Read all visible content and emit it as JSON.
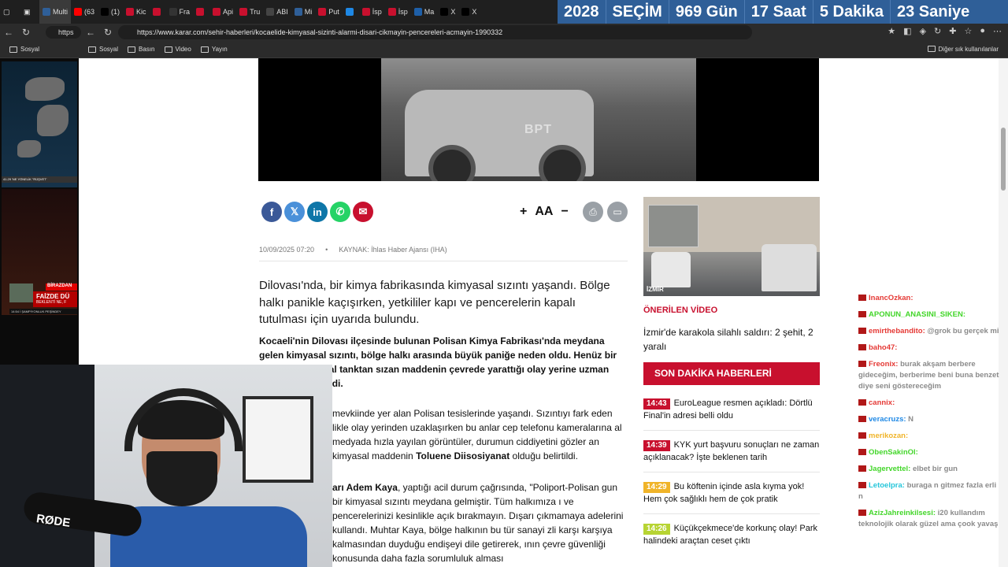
{
  "tabs": [
    {
      "label": "Multi",
      "color": "#2f5f98",
      "active": true
    },
    {
      "label": "(63",
      "color": "#ff0000"
    },
    {
      "label": "(1)",
      "color": "#000000"
    },
    {
      "label": "Kic",
      "color": "#c8102e"
    },
    {
      "label": "",
      "color": "#c8102e"
    },
    {
      "label": "Fra",
      "color": "#333333"
    },
    {
      "label": "",
      "color": "#c8102e"
    },
    {
      "label": "Api",
      "color": "#c8102e"
    },
    {
      "label": "Tru",
      "color": "#c8102e"
    },
    {
      "label": "ABI",
      "color": "#444444"
    },
    {
      "label": "Mi",
      "color": "#2f5f98"
    },
    {
      "label": "Put",
      "color": "#c8102e"
    },
    {
      "label": "",
      "color": "#1e88e5"
    },
    {
      "label": "İsp",
      "color": "#c8102e"
    },
    {
      "label": "İsp",
      "color": "#c8102e"
    },
    {
      "label": "Ma",
      "color": "#1e5fa8"
    },
    {
      "label": "X",
      "color": "#000000"
    },
    {
      "label": "X",
      "color": "#000000"
    }
  ],
  "countdown": {
    "year": "2028",
    "label": "SEÇİM",
    "days": "969 Gün",
    "hours": "17 Saat",
    "minutes": "5 Dakika",
    "seconds": "23 Saniye"
  },
  "address": {
    "mini": "https",
    "url": "https://www.karar.com/sehir-haberleri/kocaelide-kimyasal-sizinti-alarmi-disari-cikmayin-pencereleri-acmayin-1990332"
  },
  "bookmarks": {
    "items": [
      "Sosyal",
      "Basın",
      "Video",
      "Yayın"
    ],
    "first": "Sosyal",
    "other": "Diğer sık kullanılanlar"
  },
  "left_panel": {
    "ticker": "41.29   'NE YÖNELİK \"RÜŞVET'",
    "band_title": "FAİZDE DÜ",
    "band_sub": "BEKLENTİ NE, F",
    "band_tag": "BİRAZDAN",
    "bottom": "14:54  İ ŞAMPİYONLUK PEŞİNDEY"
  },
  "video": {
    "watermark": "BPT"
  },
  "share": {
    "facebook": "f",
    "x": "𝕏",
    "linkedin": "in",
    "whatsapp": "✆",
    "email": "✉"
  },
  "font_controls": {
    "plus": "+",
    "aa": "AA",
    "minus": "−"
  },
  "article": {
    "date": "10/09/2025 07:20",
    "source": "KAYNAK: İhlas Haber Ajansı (IHA)",
    "lead": "Dilovası'nda, bir kimya fabrikasında kimyasal sızıntı yaşandı. Bölge halkı panikle kaçışırken, yetkililer kapı ve pencerelerin kapalı tutulması için uyarıda bulundu.",
    "bold_para": "Kocaeli'nin Dilovası ilçesinde bulunan Polisan Kimya Fabrikası'nda meydana gelen kimyasal sızıntı, bölge halkı arasında büyük paniğe neden oldu. Henüz bir sebeple kimyasal tanktan sızan maddenin çevrede yarattığı olay yerine uzman ekipler sevk edildi.",
    "p1_a": "mevkiinde yer alan Polisan tesislerinde yaşandı. Sızıntıyı fark eden likle olay yerinden uzaklaşırken bu anlar cep telefonu kameralarına al medyada hızla yayılan görüntüler, durumun ciddiyetini gözler an kimyasal maddenin ",
    "p1_bold": "Toluene Diisosiyanat",
    "p1_b": " olduğu belirtildi.",
    "p2_bold": "arı Adem Kaya",
    "p2_a": ", yaptığı acil durum çağrısında, \"Poliport-Polisan gun bir kimyasal sızıntı meydana gelmiştir. Tüm halkımıza ı ve pencerelerinizi kesinlikle açık bırakmayın. Dışarı çıkmamaya adelerini kullandı. Muhtar Kaya, bölge halkının bu tür sanayi zli karşı karşıya kalmasından duyduğu endişeyi dile getirerek, ının çevre güvenliği konusunda daha fazla sorumluluk alması"
  },
  "sidebar": {
    "image_label": "İZMİR",
    "category": "ÖNERİLEN VİDEO",
    "video_title": "İzmir'de karakola silahlı saldırı: 2 şehit, 2 yaralı",
    "breaking_title": "SON DAKİKA HABERLERİ",
    "news": [
      {
        "time": "14:43",
        "color": "#c8102e",
        "title": "EuroLeague resmen açıkladı: Dörtlü Final'in adresi belli oldu"
      },
      {
        "time": "14:39",
        "color": "#c8102e",
        "title": "KYK yurt başvuru sonuçları ne zaman açıklanacak? İşte beklenen tarih"
      },
      {
        "time": "14:29",
        "color": "#f0b429",
        "title": "Bu köftenin içinde asla kıyma yok! Hem çok sağlıklı hem de çok pratik"
      },
      {
        "time": "14:26",
        "color": "#b7d433",
        "title": "Küçükçekmece'de korkunç olay! Park halindeki araçtan ceset çıktı"
      }
    ]
  },
  "webcam": {
    "brand": "RØDE"
  },
  "chat": [
    {
      "user": "InancOzkan:",
      "color": "#e53935",
      "msg": ""
    },
    {
      "user": "APONUN_ANASINI_SIKEN:",
      "color": "#43d62a",
      "msg": ""
    },
    {
      "user": "emirthebandito:",
      "color": "#e53935",
      "msg": "@grok bu gerçek mi"
    },
    {
      "user": "baho47:",
      "color": "#e53935",
      "msg": ""
    },
    {
      "user": "Freonix:",
      "color": "#e53935",
      "msg": "burak akşam berbere gideceğim, berberime beni buna benzet diye seni göstereceğim"
    },
    {
      "user": "cannix:",
      "color": "#e53935",
      "msg": ""
    },
    {
      "user": "veracruzs:",
      "color": "#1e88e5",
      "msg": "N"
    },
    {
      "user": "merikozan:",
      "color": "#f0b429",
      "msg": ""
    },
    {
      "user": "ObenSakinOl:",
      "color": "#43d62a",
      "msg": ""
    },
    {
      "user": "Jagervettel:",
      "color": "#43d62a",
      "msg": "elbet bir gun"
    },
    {
      "user": "Letoelpra:",
      "color": "#26c6da",
      "msg": "buraga n gitmez fazla erli n"
    },
    {
      "user": "AzizJahreinkilsesi:",
      "color": "#43d62a",
      "msg": "i20 kullandım teknolojik olarak güzel ama çook yavaş"
    }
  ]
}
